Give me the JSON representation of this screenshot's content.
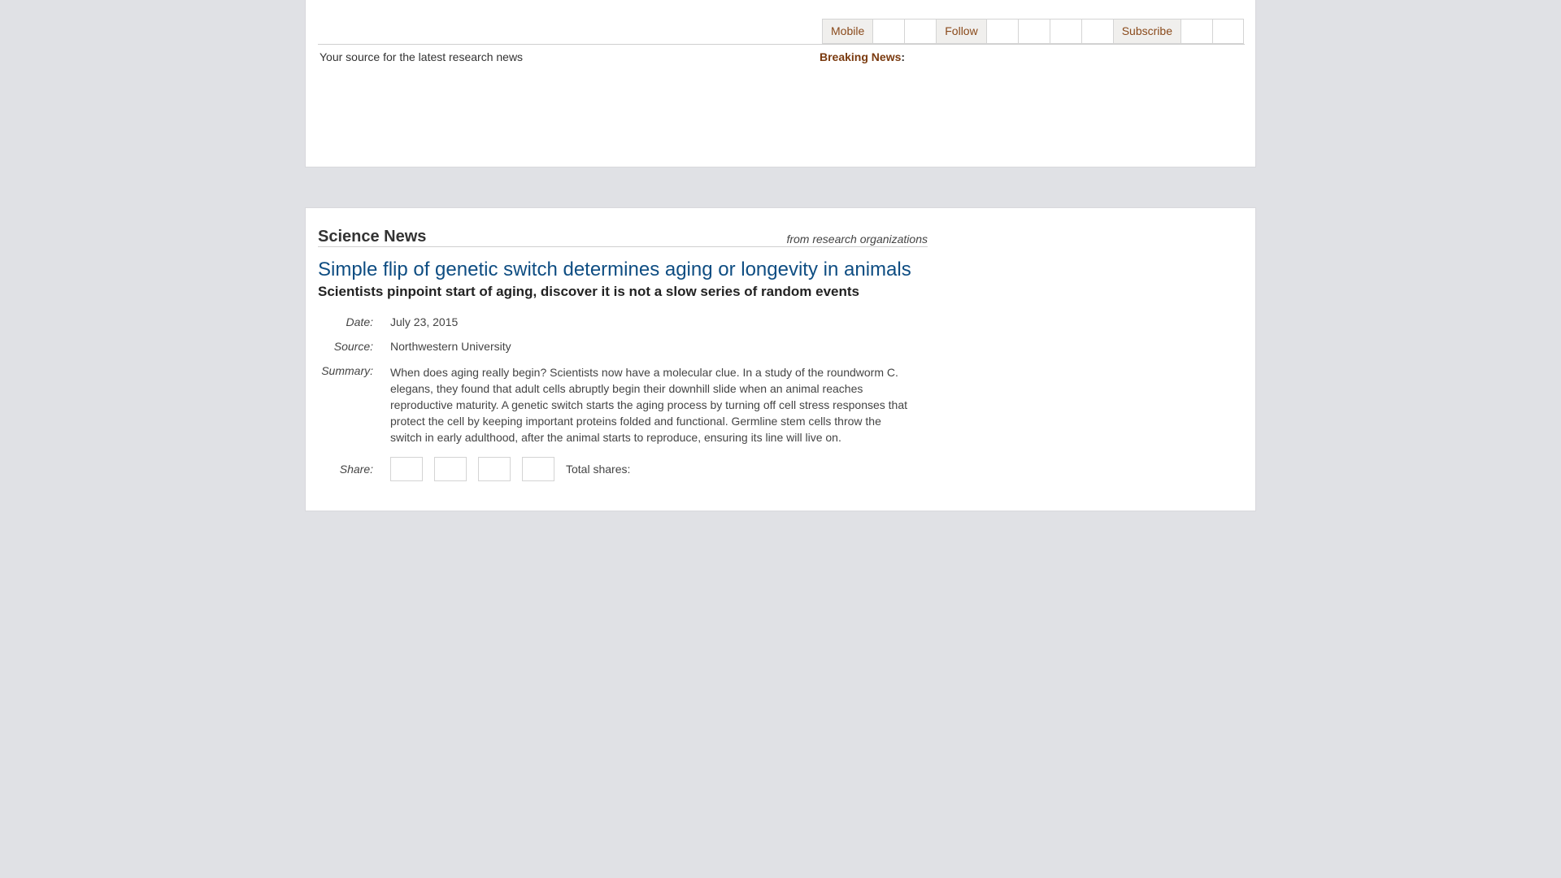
{
  "header": {
    "toolbar": {
      "mobile_label": "Mobile",
      "follow_label": "Follow",
      "subscribe_label": "Subscribe"
    },
    "tagline": "Your source for the latest research news",
    "breaking_label": "Breaking News",
    "breaking_colon": ":"
  },
  "section": {
    "title": "Science News",
    "from": "from research organizations"
  },
  "article": {
    "headline": "Simple flip of genetic switch determines aging or longevity in animals",
    "subhead": "Scientists pinpoint start of aging, discover it is not a slow series of random events",
    "date_label": "Date:",
    "date": "July 23, 2015",
    "source_label": "Source:",
    "source": "Northwestern University",
    "summary_label": "Summary:",
    "summary": "When does aging really begin? Scientists now have a molecular clue. In a study of the roundworm C. elegans, they found that adult cells abruptly begin their downhill slide when an animal reaches reproductive maturity. A genetic switch starts the aging process by turning off cell stress responses that protect the cell by keeping important proteins folded and functional. Germline stem cells throw the switch in early adulthood, after the animal starts to reproduce, ensuring its line will live on.",
    "share_label": "Share:",
    "total_shares_label": "Total shares:"
  }
}
